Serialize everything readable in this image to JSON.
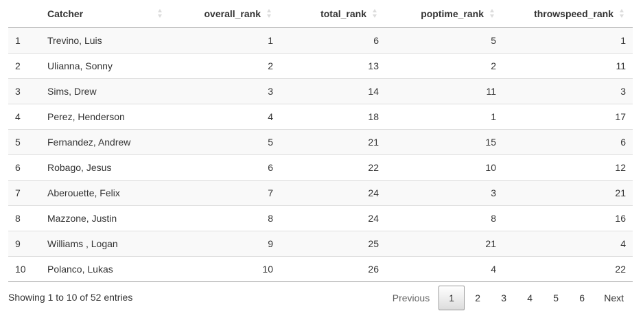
{
  "table": {
    "columns": [
      {
        "key": "idx",
        "label": ""
      },
      {
        "key": "catcher",
        "label": "Catcher"
      },
      {
        "key": "overall_rank",
        "label": "overall_rank"
      },
      {
        "key": "total_rank",
        "label": "total_rank"
      },
      {
        "key": "poptime_rank",
        "label": "poptime_rank"
      },
      {
        "key": "throwspeed_rank",
        "label": "throwspeed_rank"
      }
    ],
    "rows": [
      [
        "1",
        "Trevino, Luis",
        "1",
        "6",
        "5",
        "1"
      ],
      [
        "2",
        "Ulianna, Sonny",
        "2",
        "13",
        "2",
        "11"
      ],
      [
        "3",
        "Sims, Drew",
        "3",
        "14",
        "11",
        "3"
      ],
      [
        "4",
        "Perez, Henderson",
        "4",
        "18",
        "1",
        "17"
      ],
      [
        "5",
        "Fernandez, Andrew",
        "5",
        "21",
        "15",
        "6"
      ],
      [
        "6",
        "Robago, Jesus",
        "6",
        "22",
        "10",
        "12"
      ],
      [
        "7",
        "Aberouette, Felix",
        "7",
        "24",
        "3",
        "21"
      ],
      [
        "8",
        "Mazzone, Justin",
        "8",
        "24",
        "8",
        "16"
      ],
      [
        "9",
        "Williams , Logan",
        "9",
        "25",
        "21",
        "4"
      ],
      [
        "10",
        "Polanco, Lukas",
        "10",
        "26",
        "4",
        "22"
      ]
    ]
  },
  "info": "Showing 1 to 10 of 52 entries",
  "pagination": {
    "previous": "Previous",
    "pages": [
      "1",
      "2",
      "3",
      "4",
      "5",
      "6"
    ],
    "current": "1",
    "next": "Next"
  }
}
